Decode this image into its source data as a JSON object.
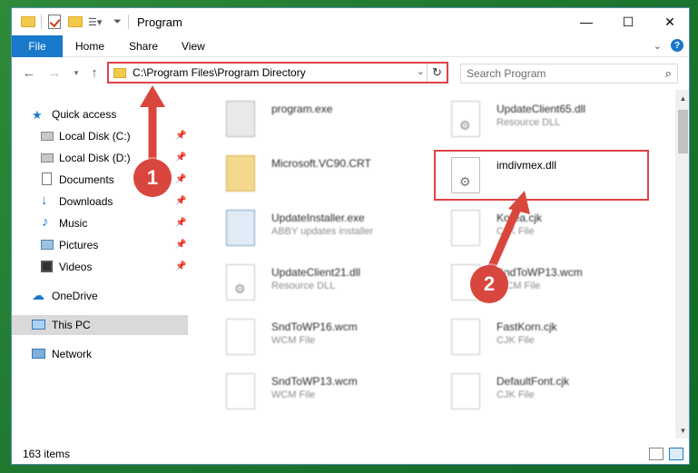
{
  "window": {
    "title": "Program",
    "controls": {
      "minimize": "—",
      "maximize": "☐",
      "close": "✕"
    }
  },
  "ribbon": {
    "tabs": [
      {
        "label": "File"
      },
      {
        "label": "Home"
      },
      {
        "label": "Share"
      },
      {
        "label": "View"
      }
    ],
    "help": "?"
  },
  "nav": {
    "address": "C:\\Program Files\\Program Directory",
    "search_placeholder": "Search Program"
  },
  "sidebar": {
    "quick_access": "Quick access",
    "items": [
      {
        "label": "Local Disk (C:)",
        "icon": "drive-icon"
      },
      {
        "label": "Local Disk (D:)",
        "icon": "drive-icon"
      },
      {
        "label": "Documents",
        "icon": "documents-icon"
      },
      {
        "label": "Downloads",
        "icon": "download-icon"
      },
      {
        "label": "Music",
        "icon": "music-icon"
      },
      {
        "label": "Pictures",
        "icon": "pictures-icon"
      },
      {
        "label": "Videos",
        "icon": "videos-icon"
      }
    ],
    "onedrive": "OneDrive",
    "this_pc": "This PC",
    "network": "Network"
  },
  "files": {
    "left": [
      {
        "name": "program.exe",
        "type": ""
      },
      {
        "name": "Microsoft.VC90.CRT",
        "type": ""
      },
      {
        "name": "UpdateInstaller.exe",
        "type": "ABBY updates installer"
      },
      {
        "name": "UpdateClient21.dll",
        "type": "Resource DLL"
      },
      {
        "name": "SndToWP16.wcm",
        "type": "WCM File"
      },
      {
        "name": "SndToWP13.wcm",
        "type": "WCM File"
      }
    ],
    "right": [
      {
        "name": "UpdateClient65.dll",
        "type": "Resource DLL"
      },
      {
        "name": "imdivmex.dll",
        "type": ""
      },
      {
        "name": "Korea.cjk",
        "type": "CJK File"
      },
      {
        "name": "SndToWP13.wcm",
        "type": "WCM File"
      },
      {
        "name": "FastKorn.cjk",
        "type": "CJK File"
      },
      {
        "name": "DefaultFont.cjk",
        "type": "CJK File"
      }
    ]
  },
  "status": {
    "items": "163 items"
  },
  "callouts": {
    "one": "1",
    "two": "2"
  },
  "colors": {
    "accent": "#1979ca",
    "highlight": "#e04343",
    "callout": "#d9463e"
  }
}
